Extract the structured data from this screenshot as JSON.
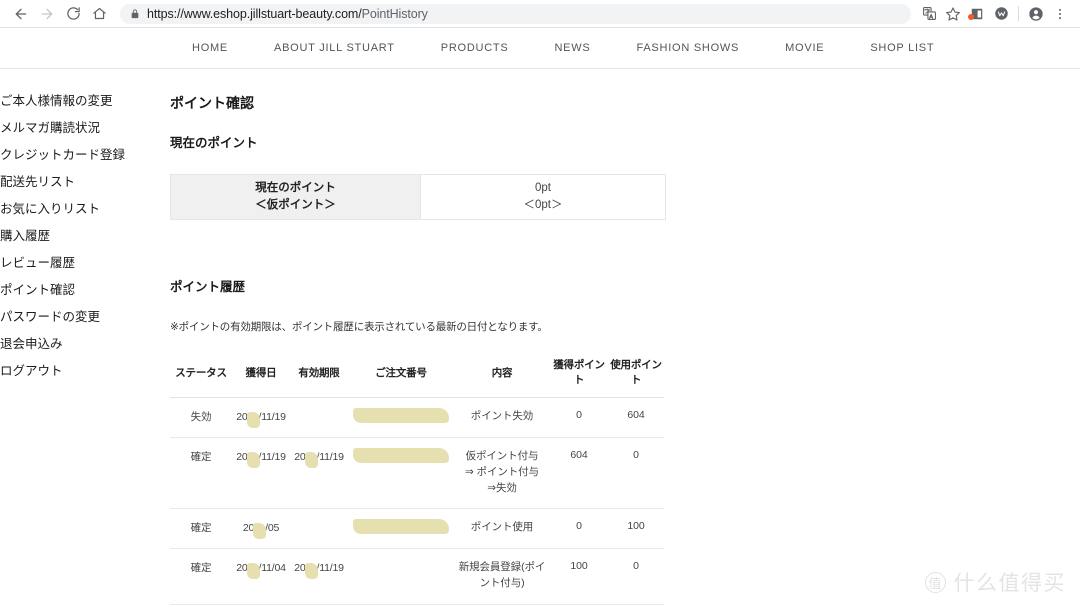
{
  "browser": {
    "back_label": "back-arrow",
    "forward_label": "forward-arrow",
    "reload_label": "reload",
    "home_label": "home",
    "url_secure": "https://www.eshop.jillstuart-beauty.com/",
    "url_path": "PointHistory",
    "full_url": "https://www.eshop.jillstuart-beauty.com/PointHistory",
    "actions": [
      "translate-icon",
      "bookmark-star-icon",
      "extension-icon",
      "extension-icon-2",
      "profile-icon",
      "menu-icon"
    ]
  },
  "site_nav": {
    "items": [
      {
        "label": "HOME"
      },
      {
        "label": "ABOUT JILL STUART"
      },
      {
        "label": "PRODUCTS"
      },
      {
        "label": "NEWS"
      },
      {
        "label": "FASHION SHOWS"
      },
      {
        "label": "MOVIE"
      },
      {
        "label": "SHOP LIST"
      }
    ]
  },
  "sidebar": {
    "items": [
      {
        "label": "ご本人様情報の変更"
      },
      {
        "label": "メルマガ購読状況"
      },
      {
        "label": "クレジットカード登録"
      },
      {
        "label": "配送先リスト"
      },
      {
        "label": "お気に入りリスト"
      },
      {
        "label": "購入履歴"
      },
      {
        "label": "レビュー履歴"
      },
      {
        "label": "ポイント確認"
      },
      {
        "label": "パスワードの変更"
      },
      {
        "label": "退会申込み"
      },
      {
        "label": "ログアウト"
      }
    ]
  },
  "main": {
    "page_title": "ポイント確認",
    "current_points_heading": "現在のポイント",
    "points_box": {
      "label_line1": "現在のポイント",
      "label_line2": "＜仮ポイント＞",
      "value_line1": "0pt",
      "value_line2": "＜0pt＞"
    },
    "history_heading": "ポイント履歴",
    "history_note": "※ポイントの有効期限は、ポイント履歴に表示されている最新の日付となります。",
    "table": {
      "headers": [
        "ステータス",
        "獲得日",
        "有効期限",
        "ご注文番号",
        "内容",
        "獲得ポイント",
        "使用ポイント"
      ],
      "rows": [
        {
          "status": "失効",
          "earned_prefix": "20",
          "earned_suffix": "/11/19",
          "earned_redacted": true,
          "expiry_prefix": "",
          "expiry_suffix": "",
          "expiry_redacted": false,
          "order_redacted": true,
          "content": "ポイント失効",
          "gain": "0",
          "use": "604"
        },
        {
          "status": "確定",
          "earned_prefix": "20",
          "earned_suffix": "/11/19",
          "earned_redacted": true,
          "expiry_prefix": "20",
          "expiry_suffix": "/11/19",
          "expiry_redacted": true,
          "order_redacted": true,
          "content": "仮ポイント付与\n⇒ ポイント付与\n⇒失効",
          "gain": "604",
          "use": "0"
        },
        {
          "status": "確定",
          "earned_prefix": "20",
          "earned_suffix": "/05",
          "earned_redacted": true,
          "expiry_prefix": "",
          "expiry_suffix": "",
          "expiry_redacted": false,
          "order_redacted": true,
          "content": "ポイント使用",
          "gain": "0",
          "use": "100"
        },
        {
          "status": "確定",
          "earned_prefix": "20",
          "earned_suffix": "/11/04",
          "earned_redacted": true,
          "expiry_prefix": "20",
          "expiry_suffix": "/11/19",
          "expiry_redacted": true,
          "order_redacted": false,
          "content": "新規会員登録(ポイント付与)",
          "gain": "100",
          "use": "0"
        }
      ]
    }
  },
  "watermark": {
    "badge": "值",
    "text": "什么值得买"
  },
  "colors": {
    "redaction": "#e6dfb0",
    "panel_gray": "#f0f0f0",
    "omnibox": "#f1f3f4",
    "extension_dot": "#f25c28"
  }
}
